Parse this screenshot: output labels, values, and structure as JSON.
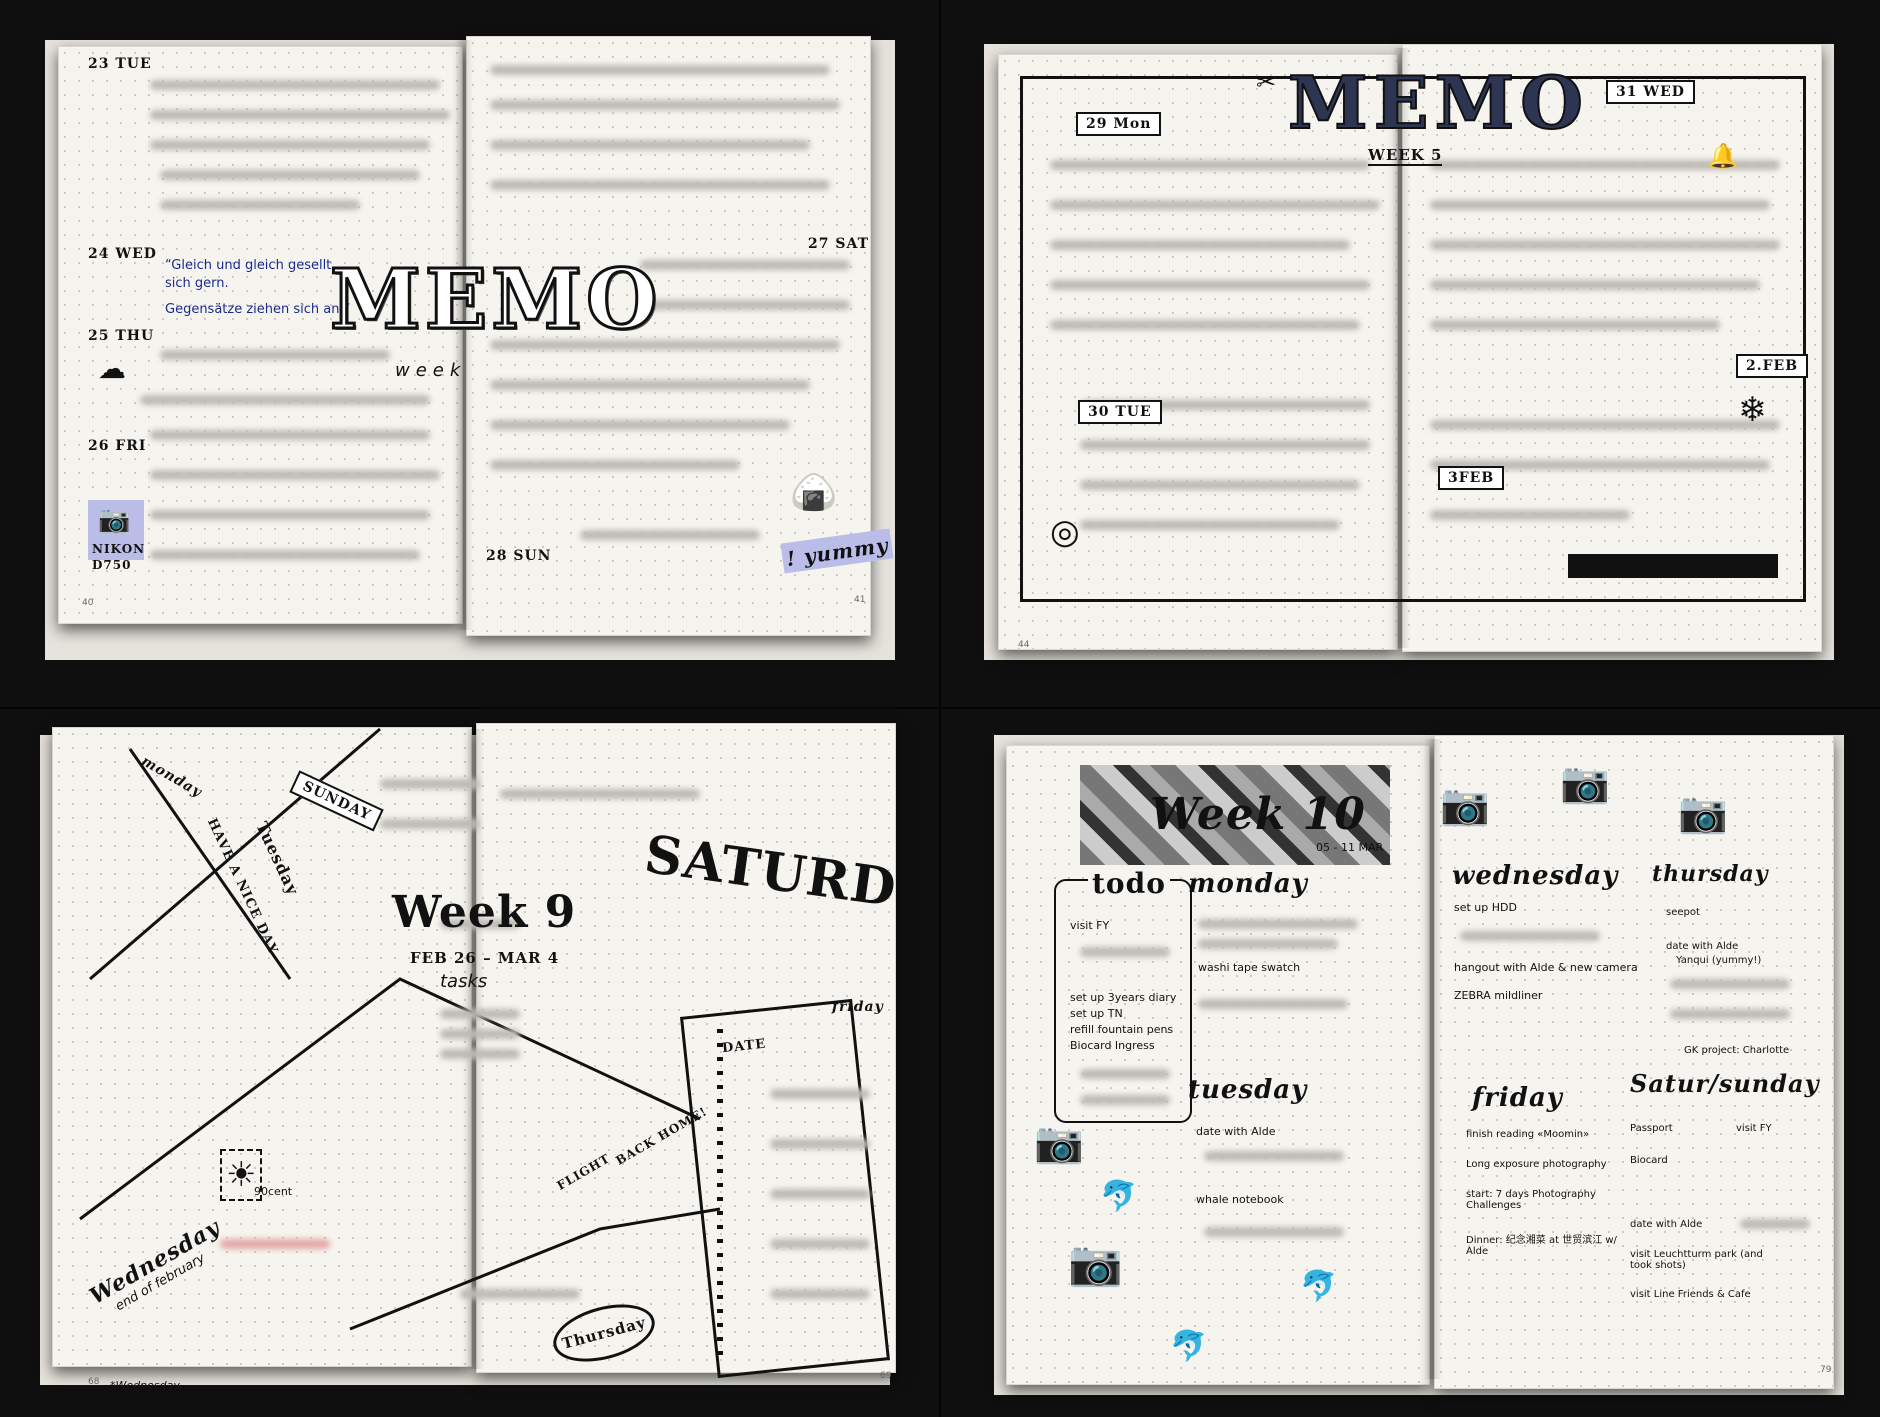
{
  "quads": {
    "top_left": {
      "dates": [
        "23 TUE",
        "24 WED",
        "25 THU",
        "26 FRI",
        "27 SAT",
        "28 SUN"
      ],
      "quote_line1": "“Gleich und gleich gesellt",
      "quote_line2": "sich gern.",
      "quote_line3": "Gegensätze ziehen sich an.”",
      "title": "MEMO",
      "subtitle": "week",
      "camera_brand": "NIKON",
      "camera_model": "D750",
      "yummy": "! yummy",
      "page_left": "40",
      "page_right": "41"
    },
    "top_right": {
      "title": "MEMO",
      "subtitle": "WEEK 5",
      "dates": [
        "29 Mon",
        "30 TUE",
        "31 WED",
        "2.FEB",
        "3FEB"
      ],
      "page_left": "44"
    },
    "bottom_left": {
      "days": [
        "monday",
        "SUNDAY",
        "Tuesday",
        "Wednesday",
        "Thursday",
        "friday",
        "SATURD"
      ],
      "have_nice_day": "HAVE A NICE DAY",
      "week_title": "Week 9",
      "date_range": "FEB 26 – MAR 4",
      "tasks": "tasks",
      "date_label": "DATE",
      "flight": "FLIGHT",
      "back_home": "BACK HOME!",
      "stamp_value": "90cent",
      "end_of_feb": "end of february",
      "footer_note": "*Wednesday",
      "page_left": "68",
      "page_right": "69"
    },
    "bottom_right": {
      "week_title": "Week 10",
      "date_range": "05 - 11 MAR",
      "todo_title": "todo",
      "todo_items": [
        "visit FY",
        "set up 3years diary",
        "set up TN",
        "refill fountain pens",
        "Biocard Ingress"
      ],
      "monday": "monday",
      "monday_item": "washi tape swatch",
      "wednesday": "wednesday",
      "wednesday_items": [
        "set up HDD",
        "hangout with Alde & new camera",
        "ZEBRA mildliner"
      ],
      "thursday": "thursday",
      "thursday_items": [
        "seepot",
        "date with Alde",
        "Yanqui (yummy!)"
      ],
      "tuesday": "tuesday",
      "tuesday_items": [
        "date with Alde",
        "whale notebook"
      ],
      "friday": "friday",
      "friday_items": [
        "finish reading «Moomin»",
        "Long exposure photography",
        "start: 7 days Photography Challenges",
        "Dinner: 纪念湘菜 at 世贸滨江 w/ Alde"
      ],
      "saturday_sunday": "Satur/sunday",
      "weekend_items": [
        "Passport",
        "Biocard",
        "visit FY",
        "date with Alde",
        "visit Leuchtturm park (and took shots)",
        "visit Line Friends & Cafe"
      ],
      "gk_project": "GK project: Charlotte",
      "page_right": "79"
    }
  },
  "colors": {
    "background": "#0f0f10",
    "paper": "#f6f4ee",
    "ink": "#111111",
    "quote_ink": "#1b2a8f",
    "highlight": "#b9bde8"
  }
}
